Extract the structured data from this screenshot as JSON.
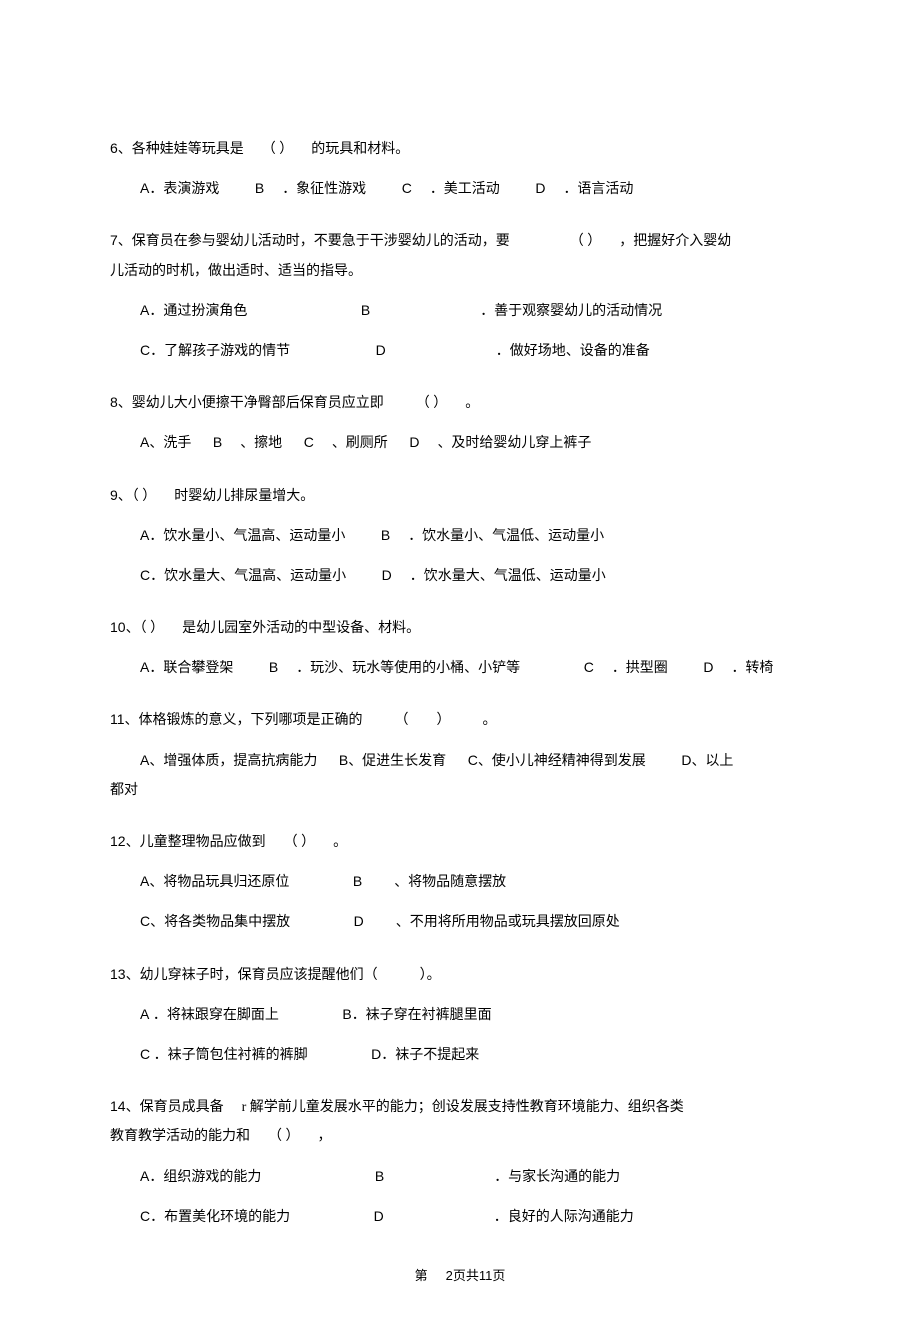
{
  "q6": {
    "text_a": "各种娃娃等玩具是",
    "blank": "（  ）",
    "text_b": "的玩具和材料。",
    "A": "．表演游戏",
    "B": "．象征性游戏",
    "C": "．美工活动",
    "D": "．语言活动"
  },
  "q7": {
    "text_a": "保育员在参与婴幼儿活动时，不要急于干涉婴幼儿的活动，要",
    "blank": "（  ）",
    "text_b": "，把握好介入婴幼",
    "cont": "儿活动的时机，做出适时、适当的指导。",
    "A": "．通过扮演角色",
    "B": "．善于观察婴幼儿的活动情况",
    "C": "．了解孩子游戏的情节",
    "D": "．做好场地、设备的准备"
  },
  "q8": {
    "text_a": "婴幼儿大小便擦干净臀部后保育员应立即",
    "blank": "（  ）",
    "text_b": "。",
    "A": "、洗手",
    "B": "、擦地",
    "C": "、刷厕所",
    "D": "、及时给婴幼儿穿上裤子"
  },
  "q9": {
    "blank": "（  ）",
    "text_b": "时婴幼儿排尿量增大。",
    "A": "．饮水量小、气温高、运动量小",
    "B": "．饮水量小、气温低、运动量小",
    "C": "．饮水量大、气温高、运动量小",
    "D": "．饮水量大、气温低、运动量小"
  },
  "q10": {
    "blank": "（  ）",
    "text_b": "是幼儿园室外活动的中型设备、材料。",
    "A": "．联合攀登架",
    "B": "．玩沙、玩水等使用的小桶、小铲等",
    "C": "．拱型圈",
    "D": "．转椅"
  },
  "q11": {
    "text_a": "体格锻炼的意义，下列哪项是正确的",
    "blank": "（　　）",
    "text_b": "。",
    "A": "、增强体质，提高抗病能力",
    "B": "、促进生长发育",
    "C": "、使小儿神经精神得到发展",
    "D": "、以上",
    "cont": "都对"
  },
  "q12": {
    "text_a": "儿童整理物品应做到",
    "blank": "（  ）",
    "text_b": "。",
    "A": "、将物品玩具归还原位",
    "B": "、将物品随意摆放",
    "C": "、将各类物品集中摆放",
    "D": "、不用将所用物品或玩具摆放回原处"
  },
  "q13": {
    "text_a": "幼儿穿袜子时，保育员应该提醒他们（　　　）。",
    "A": "．将袜跟穿在脚面上",
    "B": "．袜子穿在衬裤腿里面",
    "C": "．袜子筒包住衬裤的裤脚",
    "D": "．袜子不提起来"
  },
  "q14": {
    "text_a": "保育员成具备",
    "text_mid": "r 解学前儿童发展水平的能力；创设发展支持性教育环境能力、组织各类",
    "cont_a": "教育教学活动的能力和",
    "blank": "（  ）",
    "cont_b": "，",
    "A": "．组织游戏的能力",
    "B": "．与家长沟通的能力",
    "C": "．布置美化环境的能力",
    "D": "．良好的人际沟通能力"
  },
  "footer": {
    "a": "第",
    "b": "2页共11页"
  }
}
